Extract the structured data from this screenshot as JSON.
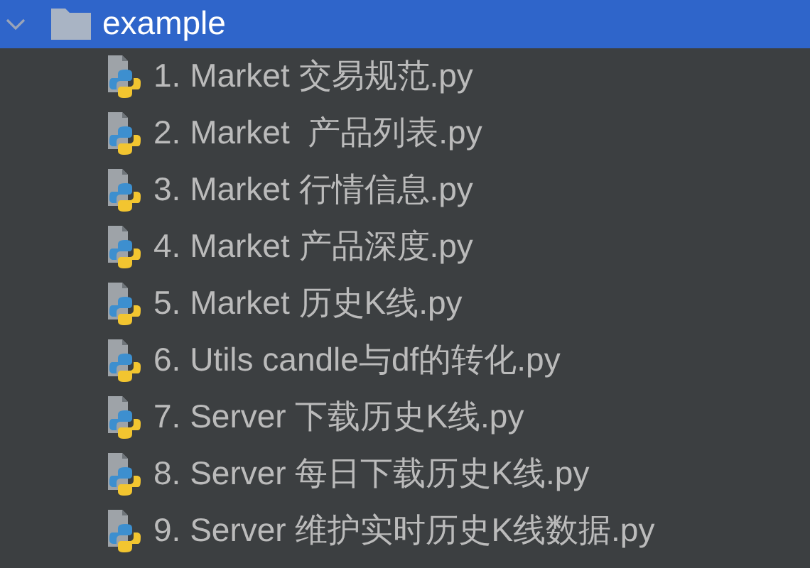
{
  "folder": {
    "name": "example",
    "expanded": true,
    "selected": true,
    "children": [
      {
        "name": "1. Market 交易规范.py",
        "selected": false
      },
      {
        "name": "2. Market  产品列表.py",
        "selected": false
      },
      {
        "name": "3. Market 行情信息.py",
        "selected": false
      },
      {
        "name": "4. Market 产品深度.py",
        "selected": false
      },
      {
        "name": "5. Market 历史K线.py",
        "selected": false
      },
      {
        "name": "6. Utils candle与df的转化.py",
        "selected": false
      },
      {
        "name": "7. Server 下载历史K线.py",
        "selected": false
      },
      {
        "name": "8. Server 每日下载历史K线.py",
        "selected": false
      },
      {
        "name": "9. Server 维护实时历史K线数据.py",
        "selected": false
      }
    ]
  }
}
